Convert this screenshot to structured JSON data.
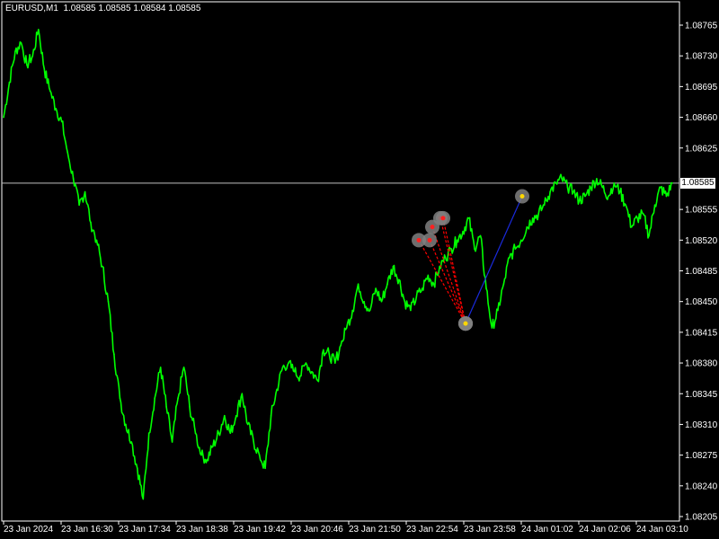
{
  "header": {
    "symbol": "EURUSD,M1",
    "ohlc": "1.08585 1.08585 1.08584 1.08585"
  },
  "current_price_label": "1.08585",
  "colors": {
    "background": "#000000",
    "price_line": "#00ff00",
    "axis": "#ffffff",
    "current_price_line": "#c0c0c0",
    "sell_trade_line": "#ff0000",
    "buy_trade_line": "#1a2adc",
    "marker_ring": "#808080"
  },
  "chart_data": {
    "type": "line",
    "symbol": "EURUSD",
    "timeframe": "M1",
    "ylim": [
      1.08205,
      1.08785
    ],
    "y_ticks": [
      1.08765,
      1.0873,
      1.08695,
      1.0866,
      1.08625,
      1.08555,
      1.0852,
      1.08485,
      1.0845,
      1.08415,
      1.0838,
      1.08345,
      1.0831,
      1.08275,
      1.0824,
      1.08205
    ],
    "y_tick_labels": [
      "1.08765",
      "1.08730",
      "1.08695",
      "1.08660",
      "1.08625",
      "1.08555",
      "1.08520",
      "1.08485",
      "1.08450",
      "1.08415",
      "1.08380",
      "1.08345",
      "1.08310",
      "1.08275",
      "1.08240",
      "1.08205"
    ],
    "x_tick_labels": [
      "23 Jan 2024",
      "23 Jan 16:30",
      "23 Jan 17:34",
      "23 Jan 18:38",
      "23 Jan 19:42",
      "23 Jan 20:46",
      "23 Jan 21:50",
      "23 Jan 22:54",
      "23 Jan 23:58",
      "24 Jan 01:02",
      "24 Jan 02:06",
      "24 Jan 03:10"
    ],
    "current_price": 1.08585,
    "series": [
      {
        "values": [
          1.0866,
          1.087,
          1.08735,
          1.08745,
          1.0872,
          1.0873,
          1.0876,
          1.08715,
          1.0869,
          1.0867,
          1.08655,
          1.0862,
          1.0859,
          1.0856,
          1.08575,
          1.0854,
          1.0852,
          1.0849,
          1.0845,
          1.0839,
          1.0834,
          1.0831,
          1.0829,
          1.0826,
          1.08225,
          1.083,
          1.0834,
          1.08375,
          1.0833,
          1.0829,
          1.0834,
          1.08375,
          1.0833,
          1.083,
          1.08275,
          1.0827,
          1.08285,
          1.083,
          1.0832,
          1.083,
          1.0832,
          1.08345,
          1.0831,
          1.0829,
          1.08275,
          1.0826,
          1.0832,
          1.0835,
          1.08375,
          1.0838,
          1.0837,
          1.08365,
          1.0838,
          1.0837,
          1.0836,
          1.08395,
          1.0839,
          1.0838,
          1.084,
          1.0842,
          1.0844,
          1.0847,
          1.0845,
          1.0844,
          1.08465,
          1.0845,
          1.0847,
          1.0849,
          1.08475,
          1.0845,
          1.0844,
          1.08455,
          1.08465,
          1.0848,
          1.0847,
          1.0849,
          1.085,
          1.0851,
          1.0852,
          1.0853,
          1.08545,
          1.0851,
          1.08525,
          1.08465,
          1.0842,
          1.0844,
          1.0847,
          1.085,
          1.0851,
          1.0852,
          1.08535,
          1.08545,
          1.0855,
          1.0856,
          1.08575,
          1.08585,
          1.0859,
          1.0858,
          1.08575,
          1.08565,
          1.0857,
          1.0858,
          1.0859,
          1.0858,
          1.0857,
          1.08585,
          1.08575,
          1.0856,
          1.08535,
          1.08545,
          1.0855,
          1.08525,
          1.0856,
          1.0858,
          1.0857,
          1.08585
        ]
      }
    ],
    "trades": [
      {
        "side": "sell",
        "open_price": 1.0852,
        "close_price": 1.08425
      },
      {
        "side": "sell",
        "open_price": 1.0852,
        "close_price": 1.08425
      },
      {
        "side": "sell",
        "open_price": 1.08535,
        "close_price": 1.08425
      },
      {
        "side": "sell",
        "open_price": 1.08545,
        "close_price": 1.08425
      },
      {
        "side": "sell",
        "open_price": 1.08545,
        "close_price": 1.08425
      },
      {
        "side": "buy",
        "open_price": 1.08425,
        "close_price": 1.0857
      }
    ]
  }
}
